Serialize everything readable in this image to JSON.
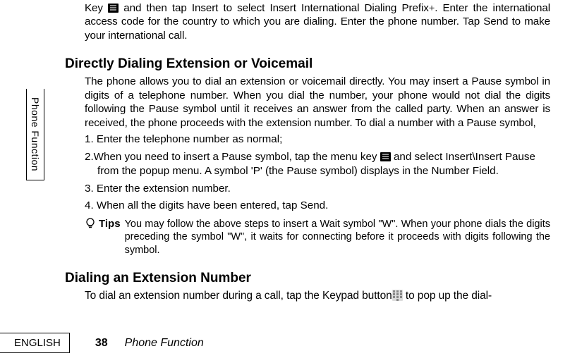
{
  "sideTab": "Phone Function",
  "topPara_a": "Key ",
  "topPara_b": " and then tap Insert to select Insert International Dialing Prefix",
  "topPara_plus": "+",
  "topPara_c": ". Enter the international access code for the country to which you are dialing. Enter the phone number. Tap Send to make your international call.",
  "h2_1": "Directly Dialing Extension or Voicemail",
  "p1": "The phone allows you to dial an extension or voicemail directly. You may insert a Pause symbol in digits of a telephone number. When you dial the number, your phone would not dial the digits following the Pause symbol until it receives an answer from the called party. When an answer is received, the phone proceeds with the extension number. To dial a number with a Pause symbol,",
  "li1": "1. Enter the telephone number as normal;",
  "li2_a": "2.When you need to insert a Pause symbol, tap the menu key ",
  "li2_b": " and select Insert\\Insert Pause",
  "li2_c": "from the popup menu. A symbol 'P' (the Pause symbol) displays in the Number Field.",
  "li3": "3. Enter the extension number.",
  "li4": "4. When all the digits have been entered, tap Send.",
  "tipsLabel": "Tips",
  "tipsBody": "You may follow the above steps to insert a Wait symbol \"W\". When your phone dials the digits preceding the symbol \"W\", it waits for connecting before it proceeds with digits following the symbol.",
  "h2_2": "Dialing an Extension Number",
  "p2_a": "To dial an extension number during a call, tap the Keypad button",
  "p2_b": " to pop up the dial-",
  "footer": {
    "lang": "ENGLISH",
    "page": "38",
    "section": "Phone Function"
  }
}
